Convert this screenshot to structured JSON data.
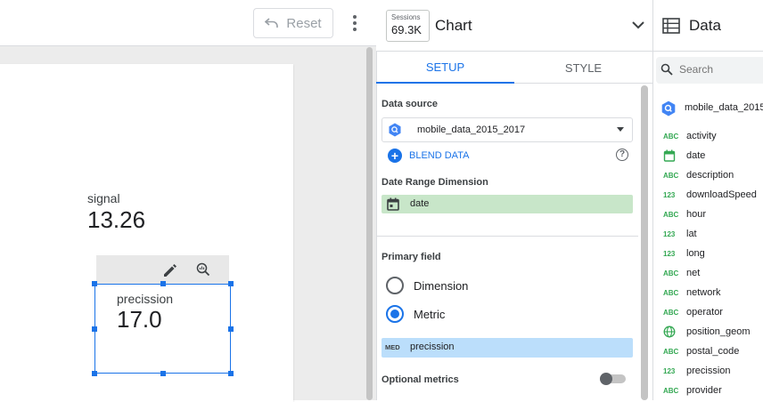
{
  "toolbar": {
    "reset_label": "Reset"
  },
  "canvas": {
    "scorecards": [
      {
        "label": "signal",
        "value": "13.26"
      },
      {
        "label": "precission",
        "value": "17.0"
      }
    ]
  },
  "properties": {
    "sessions_label": "Sessions",
    "sessions_value": "69.3K",
    "chart_title": "Chart",
    "tabs": [
      {
        "label": "SETUP"
      },
      {
        "label": "STYLE"
      }
    ],
    "data_source_title": "Data source",
    "data_source_name": "mobile_data_2015_2017",
    "blend_label": "BLEND DATA",
    "date_range_title": "Date Range Dimension",
    "date_range_field": "date",
    "primary_field_title": "Primary field",
    "dimension_label": "Dimension",
    "metric_label": "Metric",
    "selected_option": "Metric",
    "metric_agg": "MED",
    "metric_field": "precission",
    "optional_metrics_title": "Optional metrics",
    "optional_metrics_enabled": false
  },
  "data_panel": {
    "title": "Data",
    "search_placeholder": "Search",
    "data_source": "mobile_data_2015",
    "fields": [
      {
        "type": "ABC",
        "name": "activity"
      },
      {
        "type": "date-icon",
        "name": "date"
      },
      {
        "type": "ABC",
        "name": "description"
      },
      {
        "type": "123",
        "name": "downloadSpeed"
      },
      {
        "type": "ABC",
        "name": "hour"
      },
      {
        "type": "123",
        "name": "lat"
      },
      {
        "type": "123",
        "name": "long"
      },
      {
        "type": "ABC",
        "name": "net"
      },
      {
        "type": "ABC",
        "name": "network"
      },
      {
        "type": "ABC",
        "name": "operator"
      },
      {
        "type": "globe-icon",
        "name": "position_geom"
      },
      {
        "type": "ABC",
        "name": "postal_code"
      },
      {
        "type": "123",
        "name": "precission"
      },
      {
        "type": "ABC",
        "name": "provider"
      }
    ]
  },
  "colors": {
    "accent": "#1a73e8",
    "dimension_chip": "#c8e6c9",
    "metric_chip": "#bbdefb",
    "field_type": "#34a853"
  }
}
